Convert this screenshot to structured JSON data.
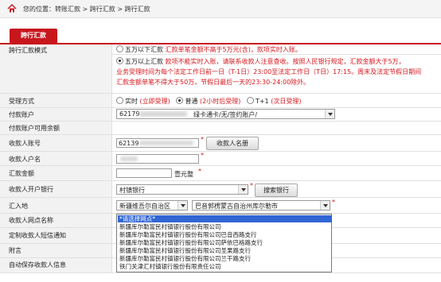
{
  "breadcrumb": {
    "text": "您的位置：转账汇款 > 跨行汇款 > 跨行汇款"
  },
  "tab": {
    "label": "跨行汇款"
  },
  "fields": {
    "mode": {
      "label": "跨行汇款模式",
      "option1_a": "五万以下汇款 ",
      "option1_b": "汇款单笔金额不高于5万元(含)，款项实时入账。",
      "option2_a": "五万以上汇款 ",
      "option2_b": "款项不能实时入账，请联系收款人注意查收。按照人民银行规定，汇款金额大于5万，",
      "option2_c": "业务受理时间为每个法定工作日前一日（T-1日）23:00至法定工作日（T日）17:15。周末及法定节假日期间",
      "option2_d": "汇款金额单笔不得大于50万，节假日最后一天的23:30-24:00除外。"
    },
    "method": {
      "label": "受理方式",
      "realtime": "实时",
      "realtime_note": "(立即受理)",
      "normal": "普通",
      "normal_note": "(2小时后受理)",
      "t1": "T+1",
      "t1_note": "(次日受理)"
    },
    "pay_account": {
      "label": "付款账户",
      "prefix": "62179",
      "value": "绿卡通卡/无/签约账户/"
    },
    "balance": {
      "label": "付款账户可用余额"
    },
    "payee_account": {
      "label": "收款人账号",
      "prefix": "62139",
      "button": "收款人名册"
    },
    "payee_name": {
      "label": "收款人户名"
    },
    "amount": {
      "label": "汇款金额",
      "unit": "壹元整"
    },
    "bank": {
      "label": "收款人开户银行",
      "value": "村镇银行",
      "button": "搜索银行"
    },
    "region": {
      "label": "汇入地",
      "province": "新疆维吾尔自治区",
      "city": "巴音郭楞蒙古自治州库尔勒市"
    },
    "branch": {
      "label": "收款人网点名称"
    },
    "sms": {
      "label": "定制收款人短信通知"
    },
    "note": {
      "label": "附言"
    },
    "autosave": {
      "label": "自动保存收款人信息"
    }
  },
  "branch_dropdown": {
    "selected": "*请选择网点*",
    "options": [
      "*请选择网点*",
      "新疆库尔勒富民村镇银行股份有限公司",
      "新疆库尔勒富民村镇银行股份有限公司巴音西路支行",
      "新疆库尔勒富民村镇银行股份有限公司萨依巴格路支行",
      "新疆库尔勒富民村镇银行股份有限公司圣果路支行",
      "新疆库尔勒富民村镇银行股份有限公司兰干路支行",
      "铁门关津汇村镇银行股份有限责任公司"
    ]
  },
  "colors": {
    "accent": "#c8161d",
    "highlight": "#3166d4",
    "note_red": "#d5161c"
  }
}
